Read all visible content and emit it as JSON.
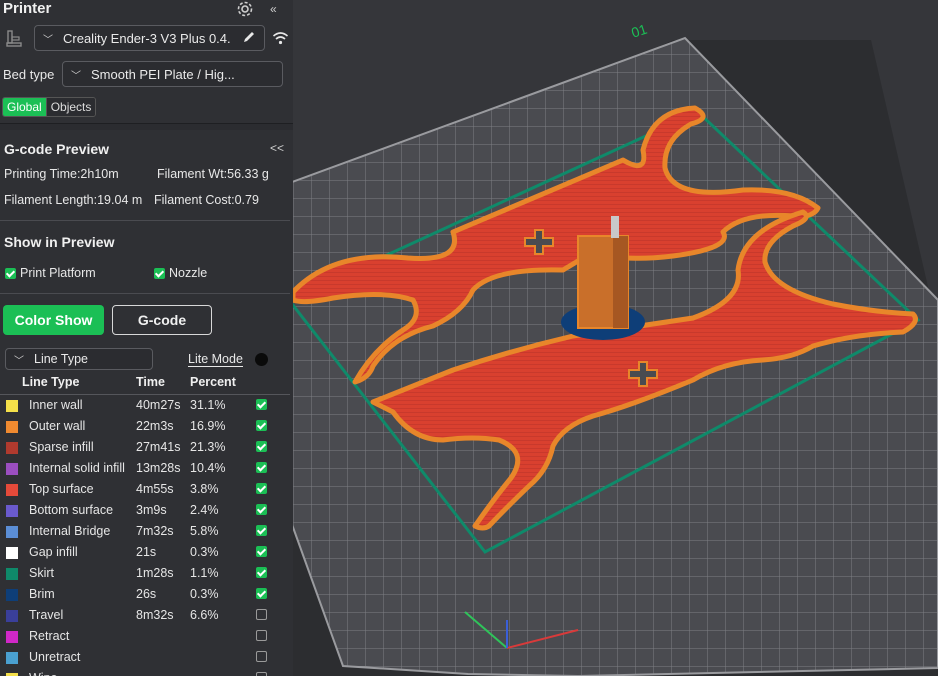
{
  "printer_section": {
    "title": "Printer",
    "printer_name": "Creality Ender-3 V3 Plus 0.4.",
    "bed_type_label": "Bed type",
    "bed_type_value": "Smooth PEI Plate / Hig...",
    "tabs": [
      "Global",
      "Objects"
    ],
    "active_tab": "Global"
  },
  "gcode_preview": {
    "title": "G-code Preview",
    "printing_time": "Printing Time:2h10m",
    "filament_wt": "Filament Wt:56.33 g",
    "filament_length": "Filament Length:19.04 m",
    "filament_cost": "Filament Cost:0.79"
  },
  "show_in_preview": {
    "title": "Show in Preview",
    "print_platform": "Print Platform",
    "nozzle": "Nozzle"
  },
  "buttons": {
    "color_show": "Color Show",
    "gcode": "G-code"
  },
  "view_type": {
    "selected": "Line Type",
    "lite_mode": "Lite Mode"
  },
  "table": {
    "headers": [
      "Line Type",
      "Time",
      "Percent"
    ],
    "rows": [
      {
        "name": "Inner wall",
        "time": "40m27s",
        "percent": "31.1%",
        "color": "#f5e04a",
        "checked": true
      },
      {
        "name": "Outer wall",
        "time": "22m3s",
        "percent": "16.9%",
        "color": "#f08a30",
        "checked": true
      },
      {
        "name": "Sparse infill",
        "time": "27m41s",
        "percent": "21.3%",
        "color": "#b03a2e",
        "checked": true
      },
      {
        "name": "Internal solid infill",
        "time": "13m28s",
        "percent": "10.4%",
        "color": "#9b4ec0",
        "checked": true
      },
      {
        "name": "Top surface",
        "time": "4m55s",
        "percent": "3.8%",
        "color": "#e54a3a",
        "checked": true
      },
      {
        "name": "Bottom surface",
        "time": "3m9s",
        "percent": "2.4%",
        "color": "#6a5acd",
        "checked": true
      },
      {
        "name": "Internal Bridge",
        "time": "7m32s",
        "percent": "5.8%",
        "color": "#5b8ed6",
        "checked": true
      },
      {
        "name": "Gap infill",
        "time": "21s",
        "percent": "0.3%",
        "color": "#ffffff",
        "checked": true
      },
      {
        "name": "Skirt",
        "time": "1m28s",
        "percent": "1.1%",
        "color": "#0f8a6a",
        "checked": true
      },
      {
        "name": "Brim",
        "time": "26s",
        "percent": "0.3%",
        "color": "#0e3e78",
        "checked": true
      },
      {
        "name": "Travel",
        "time": "8m32s",
        "percent": "6.6%",
        "color": "#3a3f9a",
        "checked": false
      },
      {
        "name": "Retract",
        "time": "",
        "percent": "",
        "color": "#d028c8",
        "checked": false
      },
      {
        "name": "Unretract",
        "time": "",
        "percent": "",
        "color": "#4aa0d0",
        "checked": false
      },
      {
        "name": "Wipe",
        "time": "",
        "percent": "",
        "color": "#f5e04a",
        "checked": false
      }
    ]
  },
  "viewport": {
    "plate_label": "01"
  }
}
